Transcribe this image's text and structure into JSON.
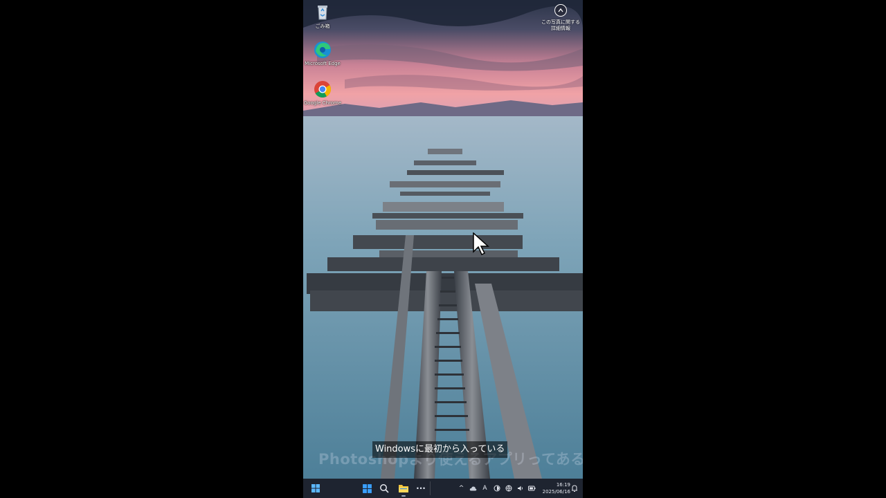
{
  "desktop": {
    "icons": [
      {
        "label": "ごみ箱",
        "icon": "recycle-bin-icon"
      },
      {
        "label": "Microsoft Edge",
        "icon": "edge-icon"
      },
      {
        "label": "Google Chrome",
        "icon": "chrome-icon"
      }
    ],
    "photo_info": {
      "label": "この写真に関する詳細情報",
      "icon": "photo-info-icon"
    }
  },
  "captions": {
    "primary": "Windowsに最初から入っている",
    "secondary": "Photoshopより使えるアプリってある?"
  },
  "taskbar": {
    "icons": [
      "windows-start-icon",
      "search-icon",
      "file-explorer-icon",
      "more-icon"
    ],
    "more_label": "···",
    "tray": {
      "chevron": "^",
      "ime": "A",
      "icons": [
        "weather-icon",
        "ime-mode-icon",
        "network-icon",
        "volume-icon",
        "battery-icon"
      ]
    },
    "clock": {
      "time": "16:19",
      "date": "2025/06/16"
    }
  },
  "colors": {
    "taskbar_bg": "#1e2430",
    "sky_pink": "#e89aa6",
    "water": "#6f9bb0",
    "start_blue": "#3aa0ff"
  }
}
